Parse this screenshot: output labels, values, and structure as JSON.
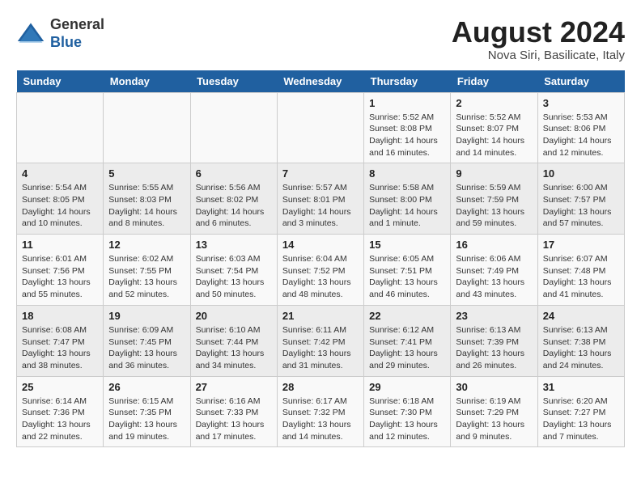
{
  "header": {
    "logo_line1": "General",
    "logo_line2": "Blue",
    "month_year": "August 2024",
    "location": "Nova Siri, Basilicate, Italy"
  },
  "weekdays": [
    "Sunday",
    "Monday",
    "Tuesday",
    "Wednesday",
    "Thursday",
    "Friday",
    "Saturday"
  ],
  "weeks": [
    [
      {
        "day": "",
        "info": ""
      },
      {
        "day": "",
        "info": ""
      },
      {
        "day": "",
        "info": ""
      },
      {
        "day": "",
        "info": ""
      },
      {
        "day": "1",
        "info": "Sunrise: 5:52 AM\nSunset: 8:08 PM\nDaylight: 14 hours\nand 16 minutes."
      },
      {
        "day": "2",
        "info": "Sunrise: 5:52 AM\nSunset: 8:07 PM\nDaylight: 14 hours\nand 14 minutes."
      },
      {
        "day": "3",
        "info": "Sunrise: 5:53 AM\nSunset: 8:06 PM\nDaylight: 14 hours\nand 12 minutes."
      }
    ],
    [
      {
        "day": "4",
        "info": "Sunrise: 5:54 AM\nSunset: 8:05 PM\nDaylight: 14 hours\nand 10 minutes."
      },
      {
        "day": "5",
        "info": "Sunrise: 5:55 AM\nSunset: 8:03 PM\nDaylight: 14 hours\nand 8 minutes."
      },
      {
        "day": "6",
        "info": "Sunrise: 5:56 AM\nSunset: 8:02 PM\nDaylight: 14 hours\nand 6 minutes."
      },
      {
        "day": "7",
        "info": "Sunrise: 5:57 AM\nSunset: 8:01 PM\nDaylight: 14 hours\nand 3 minutes."
      },
      {
        "day": "8",
        "info": "Sunrise: 5:58 AM\nSunset: 8:00 PM\nDaylight: 14 hours\nand 1 minute."
      },
      {
        "day": "9",
        "info": "Sunrise: 5:59 AM\nSunset: 7:59 PM\nDaylight: 13 hours\nand 59 minutes."
      },
      {
        "day": "10",
        "info": "Sunrise: 6:00 AM\nSunset: 7:57 PM\nDaylight: 13 hours\nand 57 minutes."
      }
    ],
    [
      {
        "day": "11",
        "info": "Sunrise: 6:01 AM\nSunset: 7:56 PM\nDaylight: 13 hours\nand 55 minutes."
      },
      {
        "day": "12",
        "info": "Sunrise: 6:02 AM\nSunset: 7:55 PM\nDaylight: 13 hours\nand 52 minutes."
      },
      {
        "day": "13",
        "info": "Sunrise: 6:03 AM\nSunset: 7:54 PM\nDaylight: 13 hours\nand 50 minutes."
      },
      {
        "day": "14",
        "info": "Sunrise: 6:04 AM\nSunset: 7:52 PM\nDaylight: 13 hours\nand 48 minutes."
      },
      {
        "day": "15",
        "info": "Sunrise: 6:05 AM\nSunset: 7:51 PM\nDaylight: 13 hours\nand 46 minutes."
      },
      {
        "day": "16",
        "info": "Sunrise: 6:06 AM\nSunset: 7:49 PM\nDaylight: 13 hours\nand 43 minutes."
      },
      {
        "day": "17",
        "info": "Sunrise: 6:07 AM\nSunset: 7:48 PM\nDaylight: 13 hours\nand 41 minutes."
      }
    ],
    [
      {
        "day": "18",
        "info": "Sunrise: 6:08 AM\nSunset: 7:47 PM\nDaylight: 13 hours\nand 38 minutes."
      },
      {
        "day": "19",
        "info": "Sunrise: 6:09 AM\nSunset: 7:45 PM\nDaylight: 13 hours\nand 36 minutes."
      },
      {
        "day": "20",
        "info": "Sunrise: 6:10 AM\nSunset: 7:44 PM\nDaylight: 13 hours\nand 34 minutes."
      },
      {
        "day": "21",
        "info": "Sunrise: 6:11 AM\nSunset: 7:42 PM\nDaylight: 13 hours\nand 31 minutes."
      },
      {
        "day": "22",
        "info": "Sunrise: 6:12 AM\nSunset: 7:41 PM\nDaylight: 13 hours\nand 29 minutes."
      },
      {
        "day": "23",
        "info": "Sunrise: 6:13 AM\nSunset: 7:39 PM\nDaylight: 13 hours\nand 26 minutes."
      },
      {
        "day": "24",
        "info": "Sunrise: 6:13 AM\nSunset: 7:38 PM\nDaylight: 13 hours\nand 24 minutes."
      }
    ],
    [
      {
        "day": "25",
        "info": "Sunrise: 6:14 AM\nSunset: 7:36 PM\nDaylight: 13 hours\nand 22 minutes."
      },
      {
        "day": "26",
        "info": "Sunrise: 6:15 AM\nSunset: 7:35 PM\nDaylight: 13 hours\nand 19 minutes."
      },
      {
        "day": "27",
        "info": "Sunrise: 6:16 AM\nSunset: 7:33 PM\nDaylight: 13 hours\nand 17 minutes."
      },
      {
        "day": "28",
        "info": "Sunrise: 6:17 AM\nSunset: 7:32 PM\nDaylight: 13 hours\nand 14 minutes."
      },
      {
        "day": "29",
        "info": "Sunrise: 6:18 AM\nSunset: 7:30 PM\nDaylight: 13 hours\nand 12 minutes."
      },
      {
        "day": "30",
        "info": "Sunrise: 6:19 AM\nSunset: 7:29 PM\nDaylight: 13 hours\nand 9 minutes."
      },
      {
        "day": "31",
        "info": "Sunrise: 6:20 AM\nSunset: 7:27 PM\nDaylight: 13 hours\nand 7 minutes."
      }
    ]
  ]
}
